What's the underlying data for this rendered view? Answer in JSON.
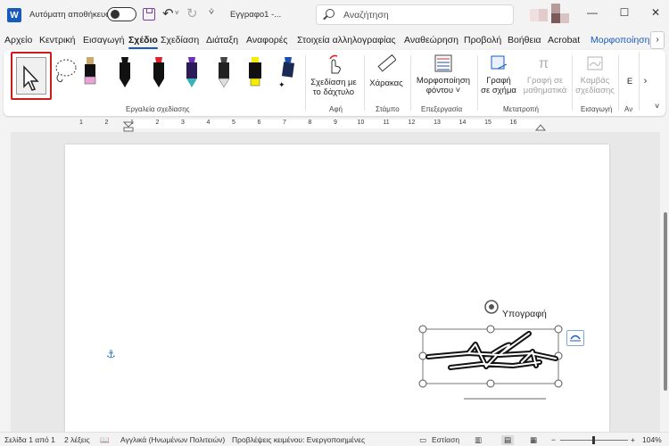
{
  "titlebar": {
    "app_icon_letter": "W",
    "autosave_label": "Αυτόματη αποθήκευση",
    "doc_name": "Εγγραφο1 -...",
    "search_placeholder": "Αναζήτηση",
    "minimize": "—",
    "maximize": "☐",
    "close": "✕"
  },
  "tabs": [
    "Αρχείο",
    "Κεντρική",
    "Εισαγωγή",
    "Σχέδιο",
    "Σχεδίαση",
    "Διάταξη",
    "Αναφορές",
    "Στοιχεία αλληλογραφίας",
    "Αναθεώρηση",
    "Προβολή",
    "Βοήθεια",
    "Acrobat",
    "Μορφοποίηση"
  ],
  "active_tab": "Σχέδιο",
  "ribbon": {
    "groups": {
      "drawing_tools": "Εργαλεία σχεδίασης",
      "touch": "Αφή",
      "stencils": "Στάμπο",
      "edit": "Επεξεργασία",
      "convert": "Μετατροπή",
      "insert": "Εισαγωγή",
      "partial": "Αν"
    },
    "draw_with_touch": [
      "Σχεδίαση με",
      "το δάχτυλο"
    ],
    "ruler": "Χάρακας",
    "background_format": [
      "Μορφοποίηση",
      "φόντου ˅"
    ],
    "ink_to_shape": [
      "Γραφή",
      "σε σχήμα"
    ],
    "ink_to_math": [
      "Γραφή σε",
      "μαθηματικά"
    ],
    "drawing_canvas": [
      "Καμβάς",
      "σχεδίασης"
    ],
    "partial_btn": "Ε"
  },
  "pens": [
    {
      "name": "pen-pink",
      "color": "#e8a3d6"
    },
    {
      "name": "pen-black",
      "color": "#111111"
    },
    {
      "name": "pen-red",
      "color": "#e0202a"
    },
    {
      "name": "pen-galaxy",
      "color": "#6a2fb5"
    },
    {
      "name": "pen-pencil",
      "color": "#555555"
    },
    {
      "name": "pen-highlighter",
      "color": "#f5ec00"
    },
    {
      "name": "pen-action",
      "color": "#1a4fb0"
    }
  ],
  "ruler_numbers": [
    "1",
    "2",
    "1",
    "2",
    "3",
    "4",
    "5",
    "6",
    "7",
    "8",
    "9",
    "10",
    "11",
    "12",
    "13",
    "14",
    "15",
    "16"
  ],
  "document": {
    "signature_label": "Υπογραφή"
  },
  "statusbar": {
    "page": "Σελίδα 1 από 1",
    "words": "2 λέξεις",
    "language": "Αγγλικά (Ηνωμένων Πολιτειών)",
    "predictions": "Προβλέψεις κειμένου: Ενεργοποιημένες",
    "focus": "Εστίαση",
    "zoom": "104%"
  },
  "colors": {
    "accent": "#185abd",
    "highlight_box": "#d11a1a"
  }
}
